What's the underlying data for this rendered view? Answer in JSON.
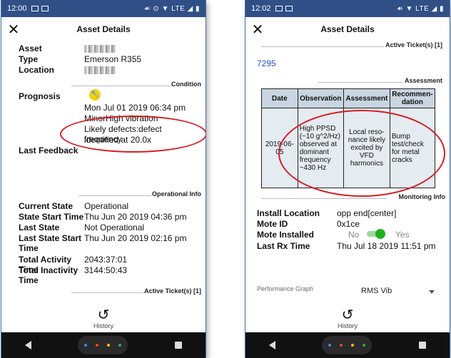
{
  "left": {
    "status": {
      "time": "12:00",
      "right": "☙ ⊙ ▼ LTE ◢ ▮"
    },
    "header": {
      "close": "✕",
      "title": "Asset Details"
    },
    "asset_rows": [
      {
        "label": "Asset",
        "value": ""
      },
      {
        "label": "Type",
        "value": "Emerson R355"
      },
      {
        "label": "Location",
        "value": ""
      }
    ],
    "condition_label": "Condition",
    "prognosis": {
      "label": "Prognosis",
      "date": "Mon Jul 01 2019 06:34 pm",
      "line2": "MinorHigh vibration",
      "line3": "Likely defects:defect frequency",
      "line4": "identified at 20.0x"
    },
    "last_feedback_label": "Last Feedback",
    "operational_label": "Operational Info",
    "op_rows": [
      {
        "label": "Current State",
        "value": "Operational"
      },
      {
        "label": "State Start Time",
        "value": "Thu Jun 20 2019 04:36 pm"
      },
      {
        "label": "Last State",
        "value": "Not Operational"
      },
      {
        "label": "Last State Start Time",
        "value": "Thu Jun 20 2019 02:16 pm"
      },
      {
        "label": "Total Activity Time",
        "value": "2043:37:01"
      },
      {
        "label": "Total Inactivity Time",
        "value": "3144:50:43"
      }
    ],
    "active_tickets_label": "Active Ticket(s) [1]",
    "history_label": "History"
  },
  "right": {
    "status": {
      "time": "12:02",
      "right": "☙ ▼ LTE ◢ ▮"
    },
    "header": {
      "close": "✕",
      "title": "Asset Details"
    },
    "active_tickets_label": "Active Ticket(s) [1]",
    "ticket_id": "7295",
    "assessment_label": "Assessment",
    "table": {
      "headers": [
        "Date",
        "Observation",
        "Assessment",
        "Recommen-dation"
      ],
      "row": [
        "2019-06-05",
        "High PPSD (~10 g^2/Hz) observed at dominant frequency ~430 Hz",
        "Local reso-nance likely excited by VFD harmonics",
        "Bump test/check for metal cracks"
      ]
    },
    "monitoring_label": "Monitoring Info",
    "rows": [
      {
        "label": "Install Location",
        "value": "opp end[center]"
      },
      {
        "label": "Mote ID",
        "value": "0x1ce"
      },
      {
        "label": "Mote Installed",
        "no": "No",
        "yes": "Yes"
      },
      {
        "label": "Last Rx Time",
        "value": "Thu Jul 18 2019 11:51 pm"
      }
    ],
    "performance": {
      "label": "Performance Graph",
      "value": "RMS Vib"
    },
    "history_label": "History"
  },
  "colors": {
    "status_bar": "#2f4f86",
    "link": "#1f4fd6",
    "annotation": "#d51e26",
    "toggle_on": "#1db11d",
    "table_header": "#c9d5e0"
  }
}
